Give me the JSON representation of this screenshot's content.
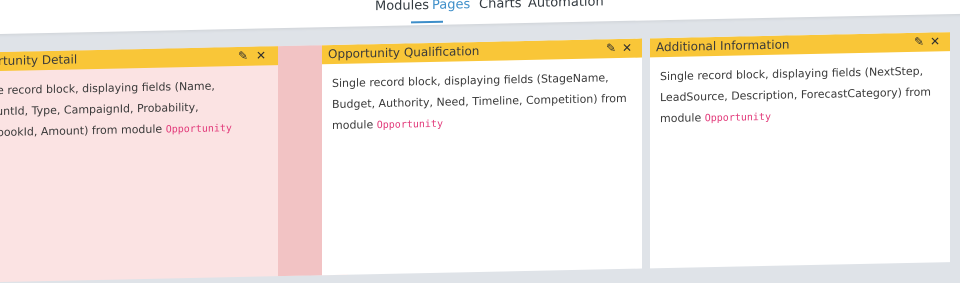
{
  "nav": {
    "tabs": [
      {
        "label": "Modules"
      },
      {
        "label": "Pages"
      },
      {
        "label": "Charts"
      },
      {
        "label": "Automation"
      }
    ],
    "active": "Pages"
  },
  "blocks": [
    {
      "title": "Opportunity Detail",
      "description": "Single record block, displaying fields (Name, AccountId, Type, CampaignId, Probability, PricebookId, Amount) from module",
      "module": "Opportunity",
      "state": "selected"
    },
    {
      "title": "Opportunity Qualification",
      "description": "Single record block, displaying fields (StageName, Budget, Authority, Need, Timeline, Competition) from module",
      "module": "Opportunity"
    },
    {
      "title": "Additional Information",
      "description": "Single record block, displaying fields (NextStep, LeadSource, Description, ForecastCategory) from module",
      "module": "Opportunity"
    }
  ],
  "icons": {
    "edit": "edit-icon",
    "close": "close-icon"
  },
  "colors": {
    "header": "#f9c638",
    "active_tab": "#3d8ec9",
    "selected_block": "#fbe3e3",
    "module_name": "#e23a7a"
  }
}
